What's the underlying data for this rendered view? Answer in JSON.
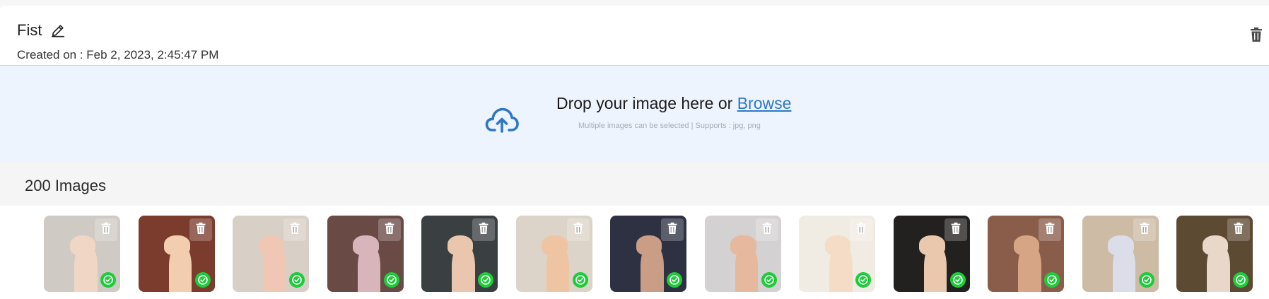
{
  "header": {
    "title": "Fist",
    "created": "Created on : Feb 2, 2023, 2:45:47 PM",
    "edit_icon": "pencil-icon",
    "delete_icon": "trash-icon"
  },
  "dropzone": {
    "text": "Drop your image here or ",
    "browse_label": "Browse",
    "subtext": "Multiple images can be selected | Supports : jpg, png",
    "icon": "cloud-upload-icon",
    "accent": "#2e77c7"
  },
  "images": {
    "count_label": "200 Images",
    "items": [
      {
        "bg": "#cfcac3",
        "arm": "#f0d6c4"
      },
      {
        "bg": "#7b3b2d",
        "arm": "#f2cdb0"
      },
      {
        "bg": "#d8cfc6",
        "arm": "#efc7b4"
      },
      {
        "bg": "#6a4a45",
        "arm": "#d7b5bb"
      },
      {
        "bg": "#3a3f42",
        "arm": "#e9c6ad"
      },
      {
        "bg": "#dcd4c8",
        "arm": "#efc4a2"
      },
      {
        "bg": "#2d3142",
        "arm": "#c99d86"
      },
      {
        "bg": "#d4d1d2",
        "arm": "#e6b89e"
      },
      {
        "bg": "#f1ece3",
        "arm": "#f4dcc6"
      },
      {
        "bg": "#23211f",
        "arm": "#e9c8ae"
      },
      {
        "bg": "#8a5d4a",
        "arm": "#d6a585"
      },
      {
        "bg": "#cdbba6",
        "arm": "#dbdde9"
      },
      {
        "bg": "#5d4a33",
        "arm": "#e9d8c9"
      }
    ]
  },
  "colors": {
    "check_green": "#1ecb3b",
    "dropzone_bg": "#eef4fd"
  }
}
